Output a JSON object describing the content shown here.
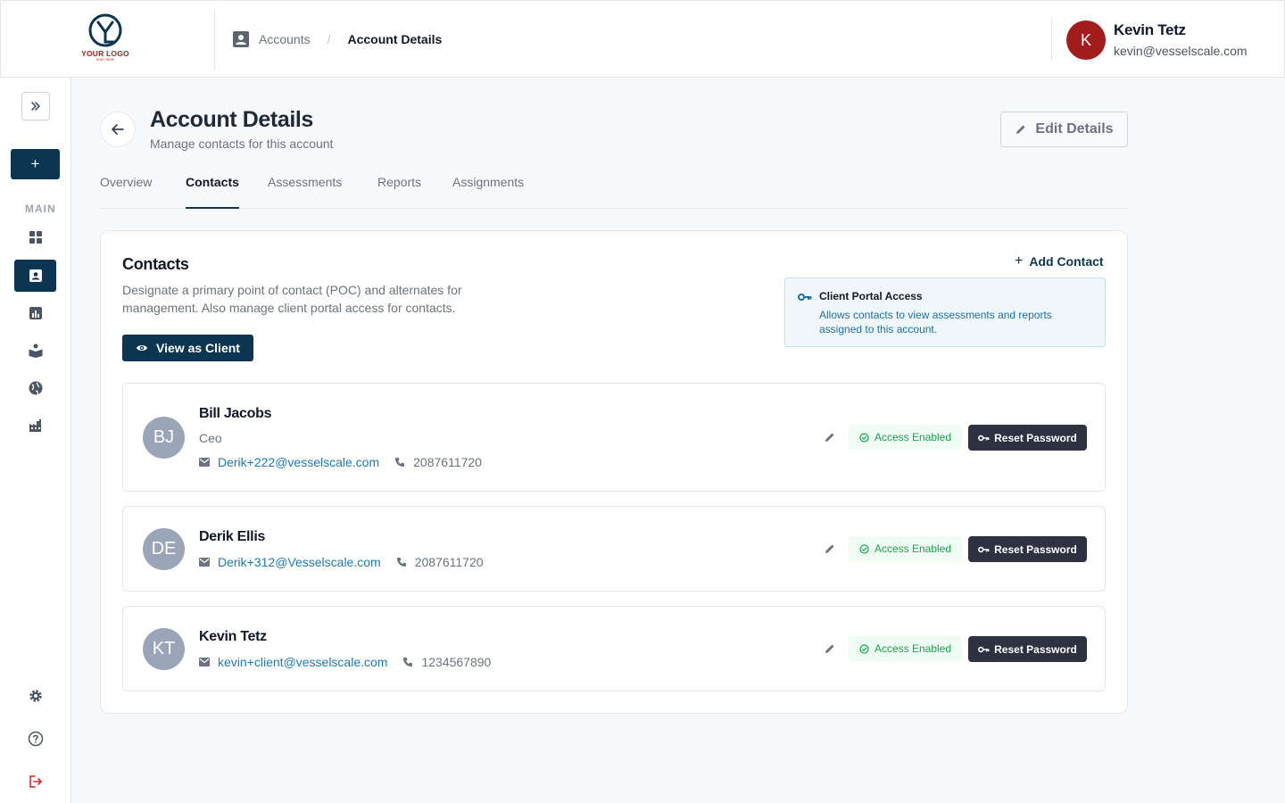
{
  "logo": {
    "text": "YOUR LOGO",
    "subtext": "DOES HERE",
    "color": "#b91c1c"
  },
  "breadcrumb": {
    "items": [
      "Accounts"
    ],
    "separator": "/",
    "current": "Account Details"
  },
  "user": {
    "initial": "K",
    "name": "Kevin Tetz",
    "email": "kevin@vesselscale.com",
    "avatar_color": "#a21c1c"
  },
  "sidebar": {
    "expand_icon": "chevrons-right-icon",
    "add_label": "+",
    "section_label": "MAIN",
    "items": [
      {
        "icon": "dashboard-icon",
        "active": false
      },
      {
        "icon": "contacts-icon",
        "active": true
      },
      {
        "icon": "chart-icon",
        "active": false
      },
      {
        "icon": "book-icon",
        "active": false
      },
      {
        "icon": "globe-icon",
        "active": false
      },
      {
        "icon": "factory-icon",
        "active": false
      }
    ],
    "bottom": [
      "gear-icon",
      "help-icon",
      "logout-icon"
    ]
  },
  "page": {
    "title": "Account Details",
    "subtitle": "Manage contacts for this account",
    "edit_label": "Edit Details"
  },
  "tabs": [
    "Overview",
    "Contacts",
    "Assessments",
    "Reports",
    "Assignments"
  ],
  "active_tab": "Contacts",
  "contacts_card": {
    "title": "Contacts",
    "description": "Designate a primary point of contact (POC) and alternates for management. Also manage client portal access for contacts.",
    "view_as_client_label": "View as Client",
    "add_contact_label": "Add Contact",
    "add_contact_plus": "+",
    "portal": {
      "title": "Client Portal Access",
      "description": "Allows contacts to view assessments and reports assigned to this account."
    }
  },
  "contacts": [
    {
      "initials": "BJ",
      "name": "Bill Jacobs",
      "role": "Ceo",
      "email": "Derik+222@vesselscale.com",
      "phone": "2087611720",
      "status": "Access Enabled",
      "action": "Reset Password"
    },
    {
      "initials": "DE",
      "name": "Derik Ellis",
      "role": "",
      "email": "Derik+312@Vesselscale.com",
      "phone": "2087611720",
      "status": "Access Enabled",
      "action": "Reset Password"
    },
    {
      "initials": "KT",
      "name": "Kevin Tetz",
      "role": "",
      "email": "kevin+client@vesselscale.com",
      "phone": "1234567890",
      "status": "Access Enabled",
      "action": "Reset Password"
    }
  ],
  "colors": {
    "primary": "#0b3550",
    "success": "#16a34a",
    "link": "#1d7bb5",
    "dark_button": "#2d3140"
  }
}
